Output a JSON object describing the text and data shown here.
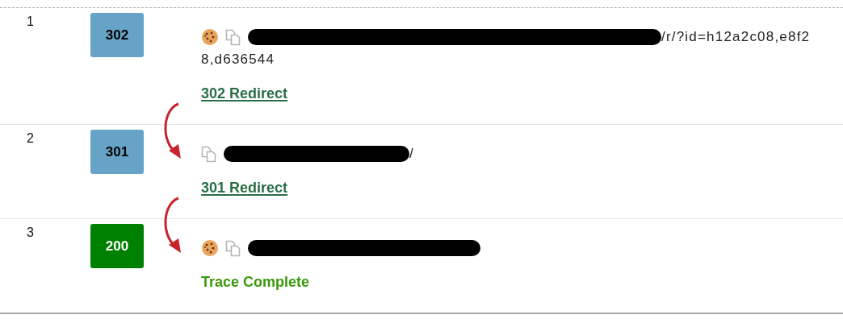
{
  "rows": [
    {
      "number": "1",
      "status": "302",
      "kind": "redirect",
      "arrow_from_previous": false,
      "cookie": true,
      "redacted": true,
      "url_lines": [
        "/r/?id=h12a2c08,e8f2",
        "8,d636544"
      ],
      "result": {
        "text": "302 Redirect",
        "kind": "link"
      }
    },
    {
      "number": "2",
      "status": "301",
      "kind": "redirect",
      "arrow_from_previous": true,
      "cookie": false,
      "redacted": true,
      "url_lines": [
        "/"
      ],
      "result": {
        "text": "301 Redirect",
        "kind": "link"
      }
    },
    {
      "number": "3",
      "status": "200",
      "kind": "success",
      "arrow_from_previous": true,
      "cookie": true,
      "redacted": true,
      "url_lines": [],
      "result": {
        "text": "Trace Complete",
        "kind": "complete"
      }
    }
  ]
}
